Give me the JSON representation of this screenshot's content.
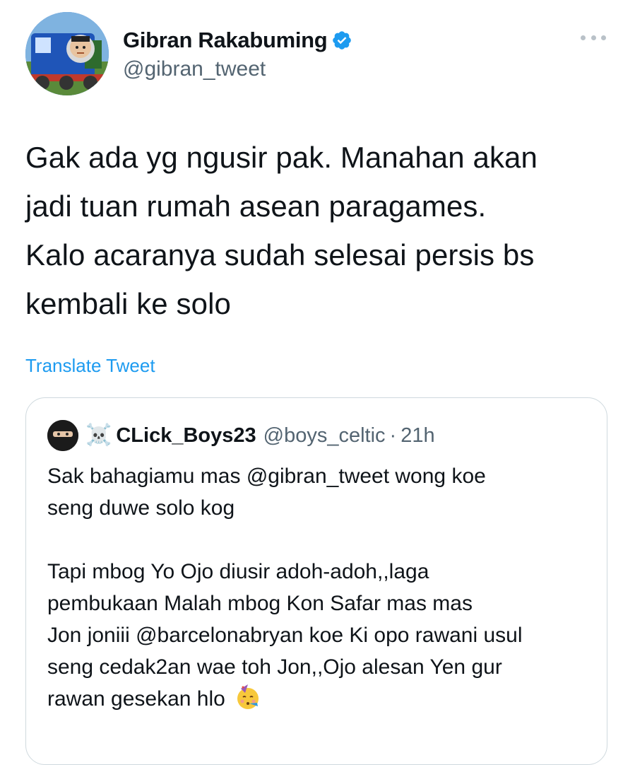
{
  "tweet": {
    "display_name": "Gibran Rakabuming",
    "handle": "@gibran_tweet",
    "verified_icon": "verified-badge-icon",
    "more_icon": "more-options-icon",
    "text_lines": [
      "Gak ada yg ngusir pak. Manahan akan",
      "jadi tuan rumah asean paragames.",
      "Kalo acaranya sudah selesai persis bs",
      "kembali ke solo"
    ],
    "translate_label": "Translate Tweet"
  },
  "quote": {
    "name_emoji": "☠️",
    "display_name": "CLick_Boys23",
    "handle": "@boys_celtic",
    "separator": "·",
    "time": "21h",
    "paragraph1_lines": [
      "Sak bahagiamu mas @gibran_tweet wong koe",
      "seng duwe solo kog"
    ],
    "paragraph2_lines": [
      "Tapi mbog Yo Ojo diusir adoh-adoh,,laga",
      "pembukaan Malah mbog Kon Safar mas mas",
      "Jon joniii @barcelonabryan koe Ki opo rawani usul",
      "seng cedak2an wae toh Jon,,Ojo alesan Yen gur",
      "rawan gesekan hlo"
    ],
    "party_icon": "party-face-emoji-icon"
  },
  "colors": {
    "link": "#1d9bf0",
    "secondary_text": "#536471",
    "border": "#cfd9de",
    "verified": "#1d9bf0"
  }
}
